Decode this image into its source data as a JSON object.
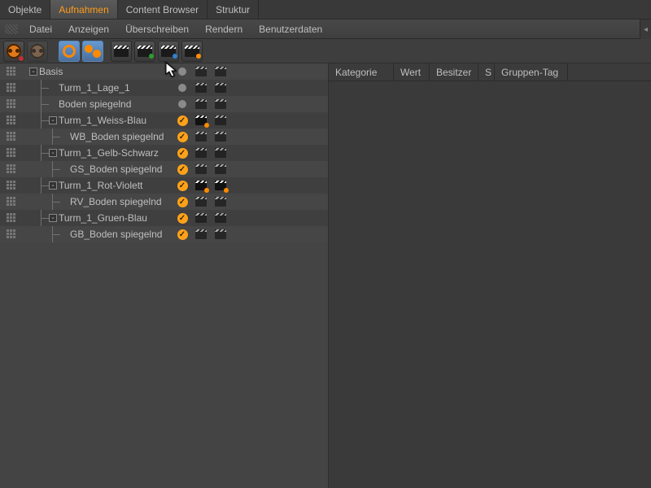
{
  "tabs": [
    {
      "label": "Objekte",
      "active": false
    },
    {
      "label": "Aufnahmen",
      "active": true
    },
    {
      "label": "Content Browser",
      "active": false
    },
    {
      "label": "Struktur",
      "active": false
    }
  ],
  "menu": [
    "Datei",
    "Anzeigen",
    "Überschreiben",
    "Rendern",
    "Benutzerdaten"
  ],
  "toolbar_icons": [
    {
      "name": "film-reel-add-icon"
    },
    {
      "name": "camera-reel-icon",
      "disabled": true
    },
    {
      "name": "ring-icon",
      "active": true
    },
    {
      "name": "blobs-icon",
      "active": true
    },
    {
      "name": "clapper-icon"
    },
    {
      "name": "clapper-play-icon"
    },
    {
      "name": "clapper-range-icon"
    },
    {
      "name": "clapper-add-icon"
    }
  ],
  "right_columns": [
    "Kategorie",
    "Wert",
    "Besitzer",
    "S",
    "Gruppen-Tag"
  ],
  "tree": [
    {
      "indent": 0,
      "expander": "-",
      "label": "Basis",
      "status": "gray",
      "films": [
        false,
        false
      ]
    },
    {
      "indent": 1,
      "expander": "",
      "label": "Turm_1_Lage_1",
      "status": "gray",
      "films": [
        false,
        false
      ]
    },
    {
      "indent": 1,
      "expander": "",
      "label": "Boden spiegelnd",
      "status": "gray",
      "films": [
        false,
        false
      ]
    },
    {
      "indent": 1,
      "expander": "-",
      "label": "Turm_1_Weiss-Blau",
      "status": "check",
      "films": [
        true,
        false
      ],
      "dot": "orange"
    },
    {
      "indent": 2,
      "expander": "",
      "label": "WB_Boden spiegelnd",
      "status": "check",
      "films": [
        false,
        false
      ]
    },
    {
      "indent": 1,
      "expander": "-",
      "label": "Turm_1_Gelb-Schwarz",
      "status": "check",
      "films": [
        false,
        false
      ]
    },
    {
      "indent": 2,
      "expander": "",
      "label": "GS_Boden spiegelnd",
      "status": "check",
      "films": [
        false,
        false
      ]
    },
    {
      "indent": 1,
      "expander": "-",
      "label": "Turm_1_Rot-Violett",
      "status": "check",
      "films": [
        true,
        true
      ],
      "dot": "orange"
    },
    {
      "indent": 2,
      "expander": "",
      "label": "RV_Boden spiegelnd",
      "status": "check",
      "films": [
        false,
        false
      ]
    },
    {
      "indent": 1,
      "expander": "-",
      "label": "Turm_1_Gruen-Blau",
      "status": "check",
      "films": [
        false,
        false
      ]
    },
    {
      "indent": 2,
      "expander": "",
      "label": "GB_Boden spiegelnd",
      "status": "check",
      "films": [
        false,
        false
      ]
    }
  ]
}
